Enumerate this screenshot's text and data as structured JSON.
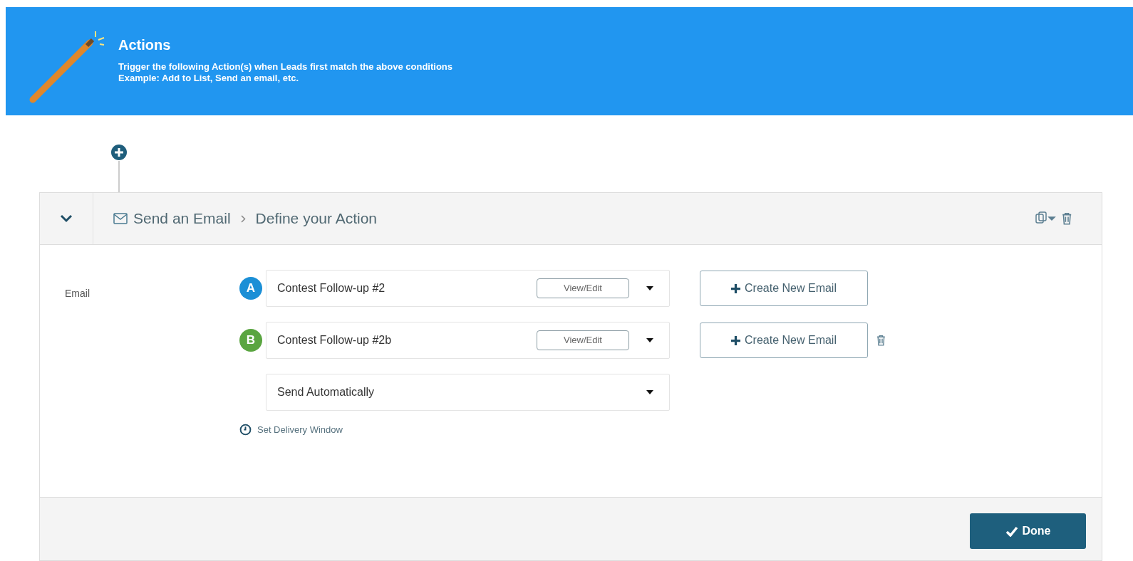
{
  "banner": {
    "title": "Actions",
    "lines": [
      "Trigger the following Action(s) when Leads first match the above conditions",
      "Example: Add to List, Send an email, etc."
    ]
  },
  "action": {
    "expanded": true,
    "breadcrumb": [
      "Send an Email",
      "Define your Action"
    ],
    "field_label": "Email",
    "emails": [
      {
        "letter": "A",
        "color": "#1b8fd6",
        "name": "Contest Follow-up #2",
        "view_button": "View/Edit",
        "create_button": "Create New Email",
        "deletable": false
      },
      {
        "letter": "B",
        "color": "#5aa540",
        "name": "Contest Follow-up #2b",
        "view_button": "View/Edit",
        "create_button": "Create New Email",
        "deletable": true
      }
    ],
    "send_mode": "Send Automatically",
    "delivery_link": "Set Delivery Window",
    "done_button": "Done"
  }
}
